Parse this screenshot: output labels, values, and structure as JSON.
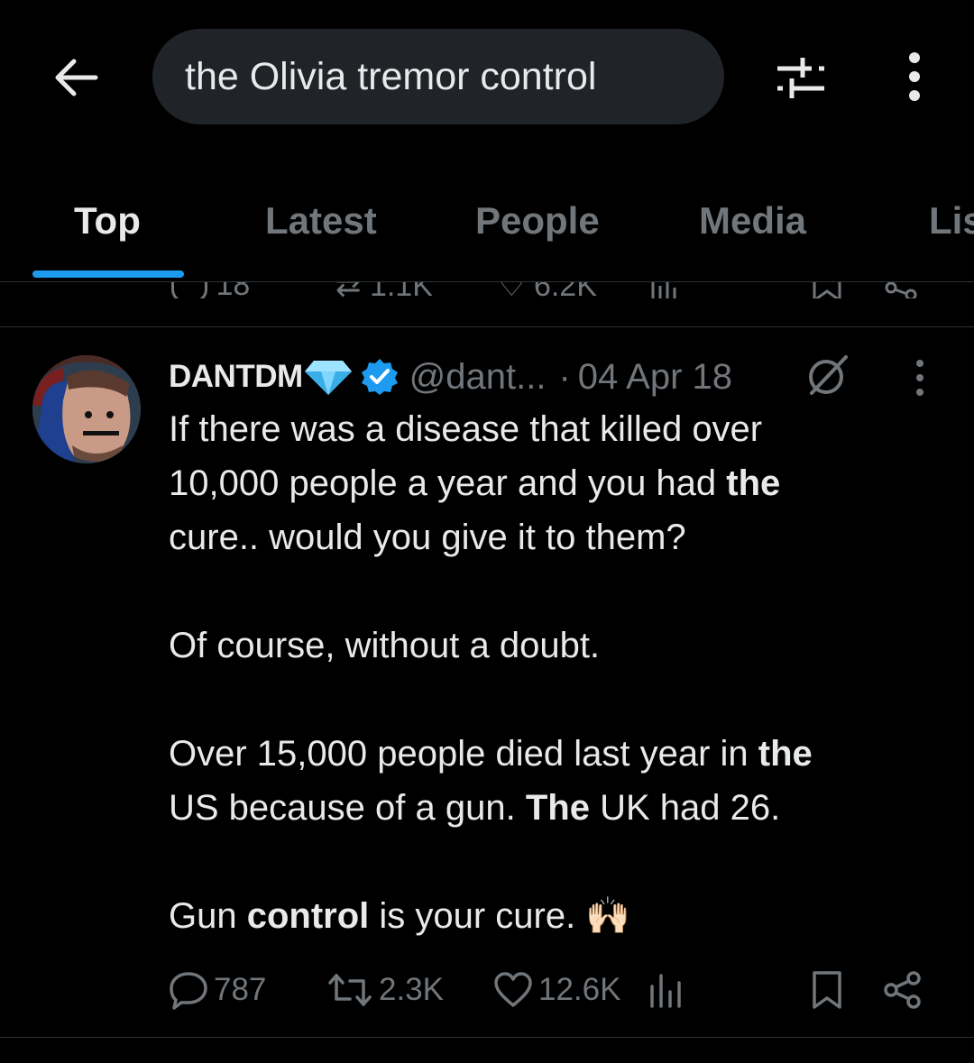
{
  "header": {
    "search_value": "the Olivia tremor control",
    "back_icon": "arrow-left-icon",
    "filter_icon": "sliders-icon",
    "more_icon": "vertical-dots-icon"
  },
  "tabs": [
    {
      "label": "Top",
      "active": true
    },
    {
      "label": "Latest",
      "active": false
    },
    {
      "label": "People",
      "active": false
    },
    {
      "label": "Media",
      "active": false
    },
    {
      "label": "Lis",
      "active": false
    }
  ],
  "prev_tweet": {
    "replies": "18",
    "reposts": "1.1K",
    "likes": "6.2K"
  },
  "tweet": {
    "display_name": "DANTDM",
    "handle": "@dant...",
    "dot": "·",
    "date": "04 Apr 18",
    "lines": [
      {
        "p1": "If there was a disease that killed over"
      },
      {
        "p1": "10,000 people a year and you had ",
        "b1": "the"
      },
      {
        "p1": "cure.. would you give it to them?"
      },
      {
        "p1": "Of course, without a doubt."
      },
      {
        "p1": "Over 15,000 people died last year in ",
        "b1": "the"
      },
      {
        "p1": "US because of a gun. ",
        "b1": "The",
        "p2": " UK had 26."
      },
      {
        "p1": "Gun ",
        "b1": "control",
        "p2": " is your cure. "
      }
    ],
    "emoji": "🙌🏻",
    "stats": {
      "replies": "787",
      "reposts": "2.3K",
      "likes": "12.6K"
    }
  },
  "colors": {
    "background": "#000000",
    "accent": "#1d9bf0",
    "text": "#e7e9ea",
    "muted": "#71767b",
    "search_bg": "#202327"
  }
}
